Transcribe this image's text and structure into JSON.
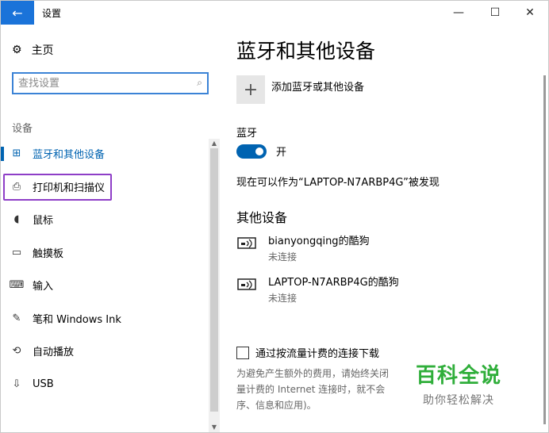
{
  "titlebar": {
    "back_icon": "arrow-left-icon",
    "title": "设置",
    "minimize_icon": "minimize-icon",
    "maximize_icon": "maximize-icon",
    "close_icon": "close-icon"
  },
  "sidebar": {
    "home_label": "主页",
    "search_placeholder": "查找设置",
    "section_label": "设备",
    "items": [
      {
        "label": "蓝牙和其他设备",
        "icon": "bluetooth-devices-icon",
        "glyph": "⊞",
        "active": true
      },
      {
        "label": "打印机和扫描仪",
        "icon": "printer-icon",
        "glyph": "⎙",
        "highlighted": true
      },
      {
        "label": "鼠标",
        "icon": "mouse-icon",
        "glyph": "◖"
      },
      {
        "label": "触摸板",
        "icon": "touchpad-icon",
        "glyph": "▭"
      },
      {
        "label": "输入",
        "icon": "keyboard-icon",
        "glyph": "⌨"
      },
      {
        "label": "笔和 Windows Ink",
        "icon": "pen-icon",
        "glyph": "✎"
      },
      {
        "label": "自动播放",
        "icon": "autoplay-icon",
        "glyph": "⟲"
      },
      {
        "label": "USB",
        "icon": "usb-icon",
        "glyph": "⇩"
      }
    ]
  },
  "main": {
    "page_title": "蓝牙和其他设备",
    "add_device_label": "添加蓝牙或其他设备",
    "bluetooth_label": "蓝牙",
    "bluetooth_toggle_state": "开",
    "bluetooth_on": true,
    "discoverable_text": "现在可以作为“LAPTOP-N7ARBP4G”被发现",
    "other_devices_title": "其他设备",
    "devices": [
      {
        "name": "bianyongqing的酷狗",
        "status": "未连接"
      },
      {
        "name": "LAPTOP-N7ARBP4G的酷狗",
        "status": "未连接"
      }
    ],
    "metered_label": "通过按流量计费的连接下载",
    "metered_checked": false,
    "metered_desc": "为避免产生额外的费用，请始终关闭量计费的 Internet 连接时，就不会序、信息和应用)。"
  },
  "watermark": {
    "title": "百科全说",
    "subtitle": "助你轻松解决"
  },
  "colors": {
    "accent": "#0063b1",
    "title_back": "#1a73d9",
    "highlight_border": "#8e3ec7",
    "watermark_green": "#2fae3a"
  }
}
